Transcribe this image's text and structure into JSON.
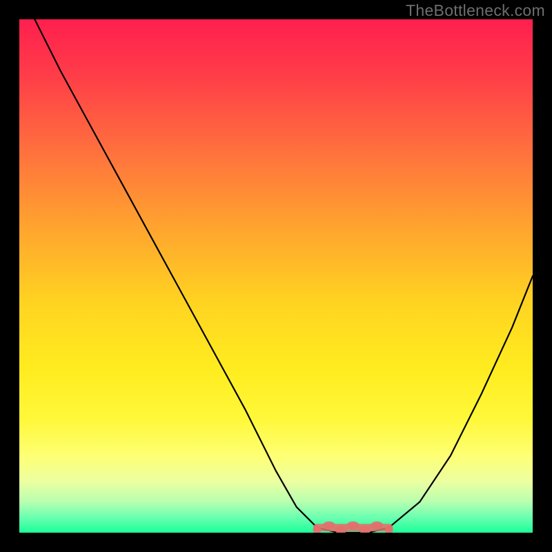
{
  "watermark": "TheBottleneck.com",
  "colors": {
    "background": "#000000",
    "watermark_text": "#6e6e6e",
    "curve_stroke": "#000000",
    "flat_marker": "#e46e6b",
    "gradient_stops": [
      {
        "offset": 0.0,
        "color": "#ff1f4e"
      },
      {
        "offset": 0.1,
        "color": "#ff3a49"
      },
      {
        "offset": 0.25,
        "color": "#ff6e3e"
      },
      {
        "offset": 0.4,
        "color": "#ffa22f"
      },
      {
        "offset": 0.55,
        "color": "#ffd321"
      },
      {
        "offset": 0.68,
        "color": "#ffec1f"
      },
      {
        "offset": 0.78,
        "color": "#fff83a"
      },
      {
        "offset": 0.85,
        "color": "#feff74"
      },
      {
        "offset": 0.9,
        "color": "#ecffa0"
      },
      {
        "offset": 0.94,
        "color": "#b8ffb0"
      },
      {
        "offset": 0.97,
        "color": "#6bffb0"
      },
      {
        "offset": 1.0,
        "color": "#1bff9a"
      }
    ]
  },
  "chart_data": {
    "type": "line",
    "title": "",
    "xlabel": "",
    "ylabel": "",
    "xlim": [
      0,
      100
    ],
    "ylim": [
      0,
      100
    ],
    "x": [
      3,
      8,
      14,
      20,
      26,
      32,
      38,
      44,
      50,
      54,
      58,
      62,
      66,
      68,
      72,
      78,
      84,
      90,
      96,
      100
    ],
    "values": [
      100,
      90,
      79,
      68,
      57,
      46,
      35,
      24,
      12,
      5,
      1,
      0,
      0,
      0,
      1,
      6,
      15,
      27,
      40,
      50
    ],
    "flat_region_x": [
      58,
      72
    ],
    "flat_region_y": 1,
    "annotations": []
  }
}
